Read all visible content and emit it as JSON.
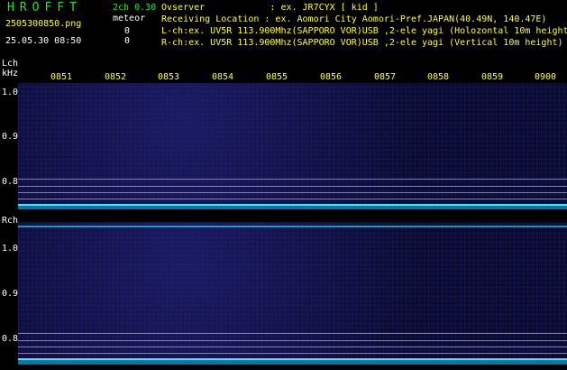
{
  "brand": "HROFFT",
  "mode": "2ch 0.30",
  "meteor_label": "meteor",
  "filename": "2505300850.png",
  "meteor_count_l": "0",
  "datetime": "25.05.30 08:50",
  "meteor_count_r": "0",
  "header_lines": [
    "Ovserver            : ex. JR7CYX [ kid ]",
    "Receiving Location : ex. Aomori City Aomori-Pref.JAPAN(40.49N, 140.47E)",
    "L-ch:ex. UV5R 113.900Mhz(SAPPORO VOR)USB ,2-ele yagi (Holozontal 10m height",
    "R-ch:ex. UV5R 113.900Mhz(SAPPORO VOR)USB ,2-ele yagi (Vertical 10m height)"
  ],
  "left_channel": {
    "label": "Lch",
    "unit": "kHz",
    "y_ticks": [
      "1.0",
      "0.9",
      "0.8"
    ]
  },
  "right_channel": {
    "label": "Rch",
    "y_ticks": [
      "1.0",
      "0.9",
      "0.8"
    ]
  },
  "time_ticks": [
    "0851",
    "0852",
    "0853",
    "0854",
    "0855",
    "0856",
    "0857",
    "0858",
    "0859",
    "0900"
  ],
  "colors": {
    "green": "#26e626",
    "yellow": "#ffff33",
    "cyan": "#2ff2ff",
    "waterfall": "#050520"
  }
}
